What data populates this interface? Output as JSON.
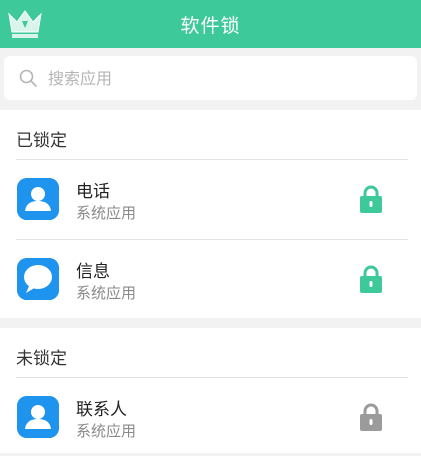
{
  "header": {
    "title": "软件锁",
    "crown_icon": "crown-icon",
    "accent": "#3ec99a"
  },
  "search": {
    "placeholder": "搜索应用",
    "value": ""
  },
  "locked": {
    "title": "已锁定",
    "items": [
      {
        "name": "电话",
        "subtitle": "系统应用",
        "icon": "contacts-person-icon",
        "locked": true
      },
      {
        "name": "信息",
        "subtitle": "系统应用",
        "icon": "message-bubble-icon",
        "locked": true
      }
    ]
  },
  "unlocked": {
    "title": "未锁定",
    "items": [
      {
        "name": "联系人",
        "subtitle": "系统应用",
        "icon": "contacts-person-icon",
        "locked": false
      }
    ]
  },
  "colors": {
    "lock_active": "#3ec99a",
    "lock_inactive": "#9b9b9b",
    "app_icon_bg": "#1e94ee"
  }
}
